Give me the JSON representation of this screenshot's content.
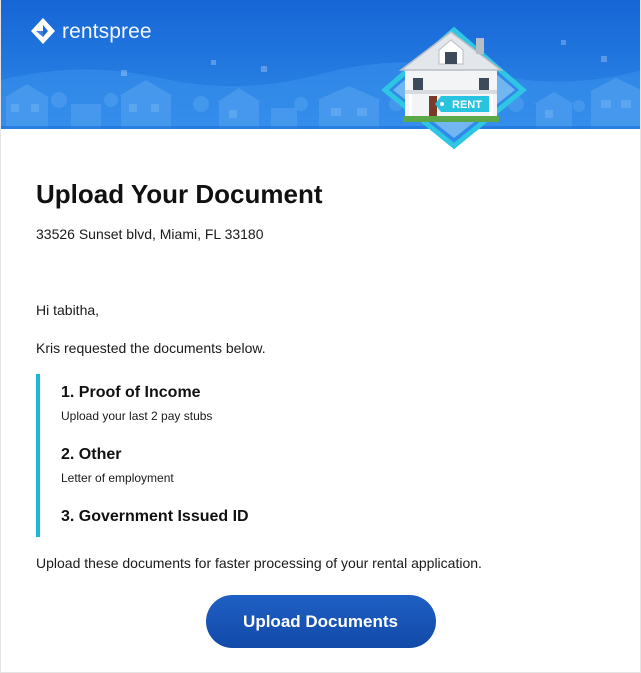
{
  "brand": {
    "name_light": "rent",
    "name_bold": "spree",
    "colors": {
      "banner_top": "#1666d6",
      "banner_bottom": "#2f8ae8",
      "accent_bar": "#1ab7d6",
      "button": "#1a56b8"
    }
  },
  "badge": {
    "label": "RENT"
  },
  "page": {
    "title": "Upload Your Document",
    "address": "33526 Sunset blvd, Miami, FL 33180",
    "greeting": "Hi tabitha,",
    "intro": "Kris requested the documents below.",
    "footer": "Upload these documents for faster processing of your rental application."
  },
  "documents": [
    {
      "title": "1. Proof of Income",
      "description": "Upload your last 2 pay stubs"
    },
    {
      "title": "2. Other",
      "description": "Letter of employment"
    },
    {
      "title": "3. Government Issued ID",
      "description": ""
    }
  ],
  "cta": {
    "label": "Upload Documents"
  }
}
